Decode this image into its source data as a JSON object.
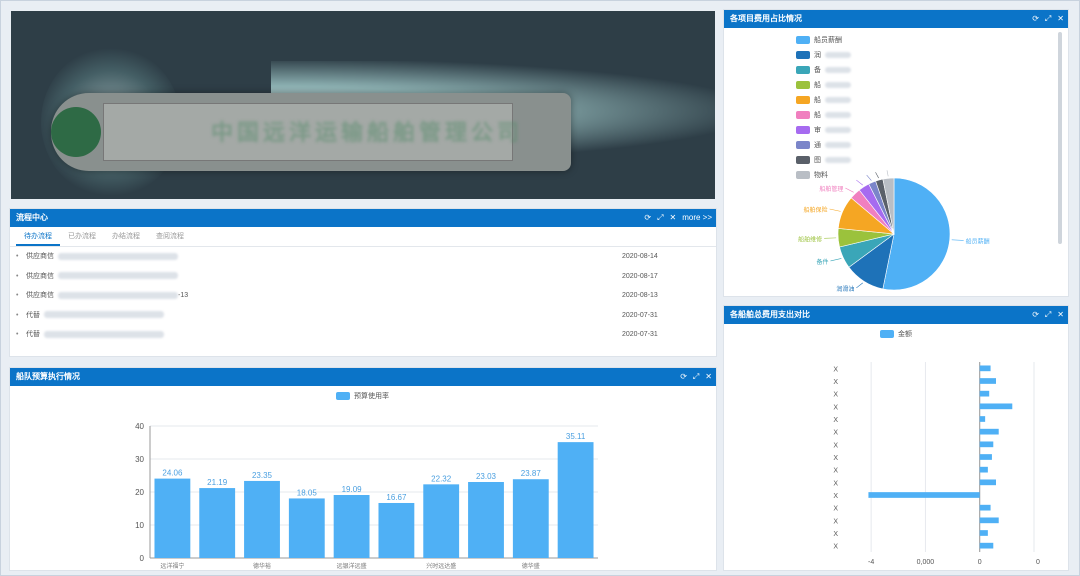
{
  "hero": {
    "ship_text": "中国远洋运输船舶管理公司"
  },
  "process": {
    "title": "流程中心",
    "tools": [
      "⟳",
      "⤢",
      "✕",
      "more >>"
    ],
    "tabs": [
      "待办流程",
      "已办流程",
      "办结流程",
      "查阅流程"
    ],
    "rows": [
      {
        "prefix": "供应商信",
        "date": "2020-08-14"
      },
      {
        "prefix": "供应商信",
        "date": "2020-08-17"
      },
      {
        "prefix": "供应商信",
        "date": "2020-08-13",
        "suffix": "-13"
      },
      {
        "prefix": "代替",
        "date": "2020-07-31"
      },
      {
        "prefix": "代替",
        "date": "2020-07-31"
      }
    ]
  },
  "budget": {
    "title": "船队预算执行情况",
    "tools": [
      "⟳",
      "⤢",
      "✕"
    ],
    "legend": "预算使用率"
  },
  "chart_data": [
    {
      "type": "bar",
      "title": "",
      "series": [
        {
          "name": "预算使用率",
          "values": [
            24.06,
            21.19,
            23.35,
            18.05,
            19.09,
            16.67,
            22.32,
            23.03,
            23.87,
            35.11
          ]
        }
      ],
      "categories": [
        "远洋福宁",
        "",
        "德华裕",
        "",
        "远银洋远盛",
        "",
        "兴时远达盛",
        "",
        "德华盛",
        ""
      ],
      "ylim": [
        0,
        40
      ],
      "yticks": [
        0,
        10,
        20,
        30,
        40
      ],
      "color": "#4fb0f5"
    },
    {
      "type": "pie",
      "title": "各项目费用占比情况",
      "labels": [
        "船员薪酬",
        "润滑油",
        "备件",
        "船舶维修",
        "船舶保险",
        "船舶管理",
        "审计",
        "通信",
        "其他",
        "物料"
      ],
      "colors": [
        "#4fb0f5",
        "#1e72b8",
        "#3aa6b8",
        "#9bc23c",
        "#f5a623",
        "#f07fbf",
        "#a66bf0",
        "#7b85c9",
        "#5a6069",
        "#b9bec5"
      ],
      "values": [
        50,
        11,
        6,
        5,
        9,
        3,
        3,
        2,
        2,
        3
      ],
      "slice_labels": [
        "船员薪酬",
        "润滑油",
        "备件",
        "船舶维修",
        "船舶保险",
        "船舶管理",
        "",
        "",
        "",
        ""
      ]
    },
    {
      "type": "bar",
      "title": "各船舶总费用支出对比",
      "orientation": "horizontal",
      "series": [
        {
          "name": "金额",
          "values": [
            40000,
            60000,
            35000,
            120000,
            20000,
            70000,
            50000,
            45000,
            30000,
            60000,
            -410000,
            40000,
            70000,
            30000,
            50000
          ]
        }
      ],
      "category_label": "X",
      "xticks": [
        "-4",
        "0,000",
        "0",
        "0"
      ],
      "color": "#4fb0f5"
    }
  ],
  "pie": {
    "title": "各项目费用占比情况",
    "tools": [
      "⟳",
      "⤢",
      "✕"
    ],
    "legend_short": [
      "船员薪酬",
      "润",
      "备",
      "船",
      "船",
      "船",
      "审",
      "通",
      "图",
      "物料"
    ]
  },
  "hbar": {
    "title": "各船舶总费用支出对比",
    "tools": [
      "⟳",
      "⤢",
      "✕"
    ],
    "legend": "金额",
    "ylabel_char": "X",
    "xtick_labels": [
      "-4",
      "0,000",
      "0",
      "0"
    ]
  }
}
